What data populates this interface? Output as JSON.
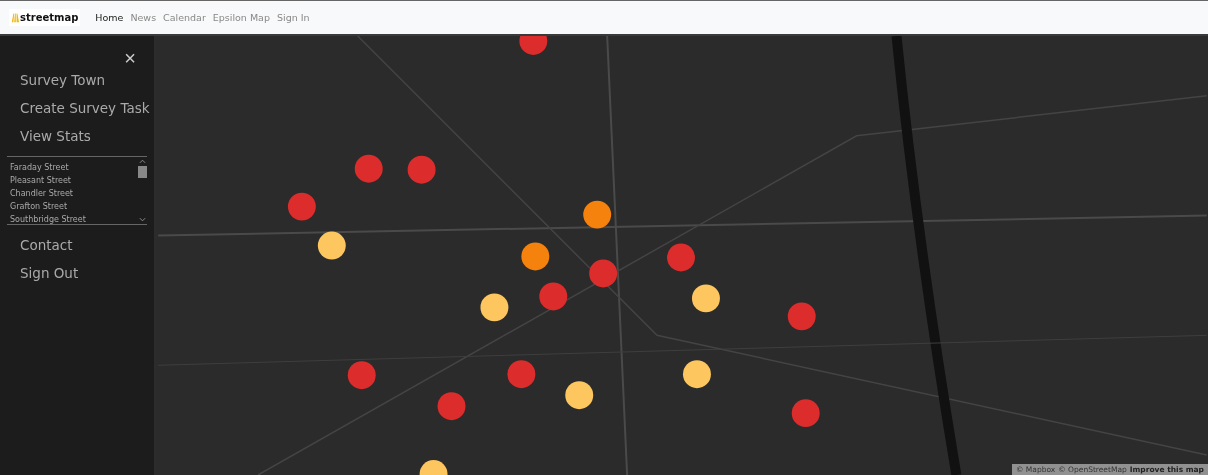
{
  "navbar": {
    "brand": "streetmap",
    "links": [
      {
        "label": "Home",
        "selected": true
      },
      {
        "label": "News",
        "selected": false
      },
      {
        "label": "Calendar",
        "selected": false
      },
      {
        "label": "Epsilon Map",
        "selected": false
      },
      {
        "label": "Sign In",
        "selected": false
      }
    ]
  },
  "sidebar": {
    "close": "×",
    "items_top": [
      "Survey Town",
      "Create Survey Task",
      "View Stats"
    ],
    "streets": [
      "Faraday Street",
      "Pleasant Street",
      "Chandler Street",
      "Grafton Street",
      "Southbridge Street"
    ],
    "items_bottom": [
      "Contact",
      "Sign Out"
    ]
  },
  "map": {
    "markers": [
      {
        "color": "#dd2c2c"
      },
      {
        "color": "#dd2c2c"
      },
      {
        "color": "#dd2c2c"
      },
      {
        "color": "#dd2c2c"
      },
      {
        "color": "#fdc65f"
      },
      {
        "color": "#f5820d"
      },
      {
        "color": "#f5820d"
      },
      {
        "color": "#dd2c2c"
      },
      {
        "color": "#dd2c2c"
      },
      {
        "color": "#dd2c2c"
      },
      {
        "color": "#fdc65f"
      },
      {
        "color": "#fdc65f"
      },
      {
        "color": "#dd2c2c"
      },
      {
        "color": "#dd2c2c"
      },
      {
        "color": "#dd2c2c"
      },
      {
        "color": "#fdc65f"
      },
      {
        "color": "#fdc65f"
      },
      {
        "color": "#dd2c2c"
      },
      {
        "color": "#dd2c2c"
      },
      {
        "color": "#fdc65f"
      }
    ],
    "attribution": [
      "© Mapbox",
      "© OpenStreetMap"
    ],
    "improve_link": "Improve this map"
  }
}
